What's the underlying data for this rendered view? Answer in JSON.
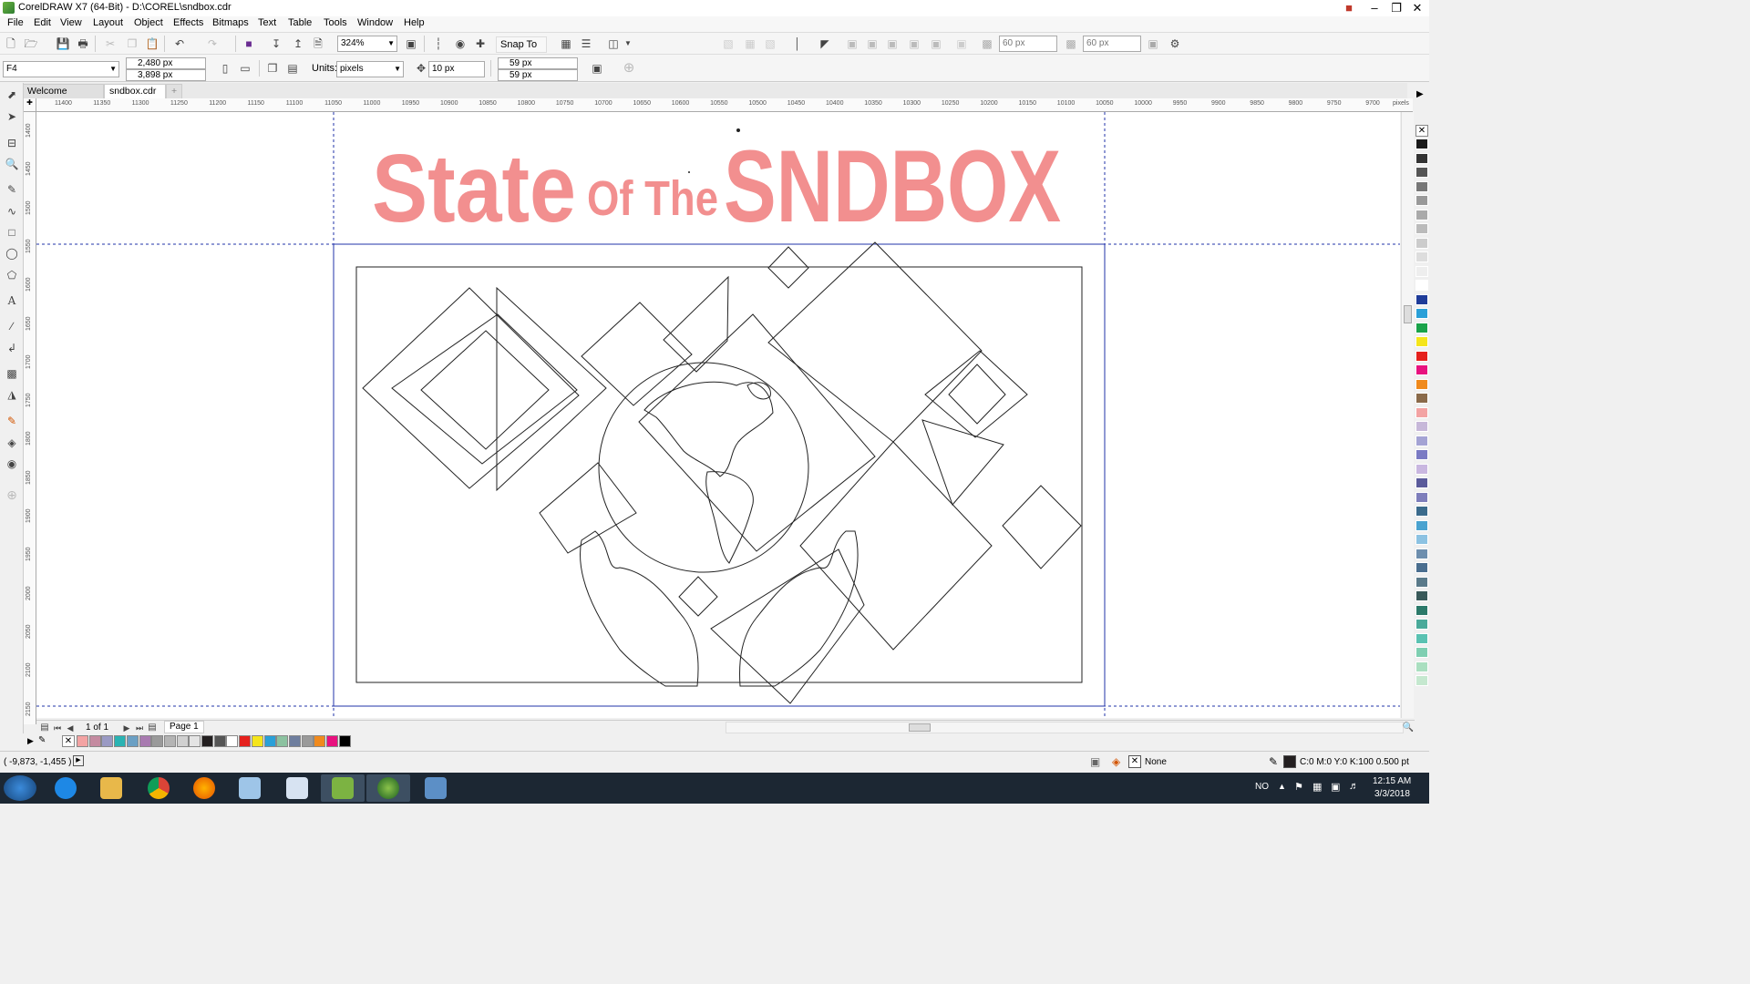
{
  "window": {
    "title": "CorelDRAW X7 (64-Bit) - D:\\COREL\\sndbox.cdr"
  },
  "menu": [
    "File",
    "Edit",
    "View",
    "Layout",
    "Object",
    "Effects",
    "Bitmaps",
    "Text",
    "Table",
    "Tools",
    "Window",
    "Help"
  ],
  "toolbar": {
    "zoom": "324%",
    "snap_label": "Snap To",
    "nudge_w": "60 px",
    "nudge_h": "60 px"
  },
  "property_bar": {
    "page_size": "F4",
    "width": "2,480 px",
    "height": "3,898 px",
    "units_label": "Units:",
    "units_value": "pixels",
    "nudge": "10 px",
    "dup_x": "59 px",
    "dup_y": "59 px"
  },
  "tabs": [
    {
      "label": "Welcome Screen",
      "active": false
    },
    {
      "label": "sndbox.cdr",
      "active": true
    }
  ],
  "hruler": {
    "ticks": [
      "11400",
      "11350",
      "11300",
      "11250",
      "11200",
      "11150",
      "11100",
      "11050",
      "11000",
      "10950",
      "10900",
      "10850",
      "10800",
      "10750",
      "10700",
      "10650",
      "10600",
      "10550",
      "10500",
      "10450",
      "10400",
      "10350",
      "10300",
      "10250",
      "10200",
      "10150",
      "10100",
      "10050",
      "10000",
      "9950",
      "9900",
      "9850",
      "9800",
      "9750",
      "9700"
    ],
    "unit": "pixels"
  },
  "vruler": {
    "ticks": [
      "1400",
      "1450",
      "1500",
      "1550",
      "1600",
      "1650",
      "1700",
      "1750",
      "1800",
      "1850",
      "1900",
      "1950",
      "2000",
      "2050",
      "2100",
      "2150"
    ],
    "unit": "pixels"
  },
  "artwork": {
    "title_word1": "State",
    "title_small": "Of The",
    "title_word2": "SNDBOX",
    "title_color": "#f28f8f"
  },
  "page_nav": {
    "count": "1 of 1",
    "page_tab": "Page 1"
  },
  "status": {
    "cursor": "( -9,873, -1,455 )",
    "fill": "None",
    "outline": "C:0 M:0 Y:0 K:100  0.500 pt",
    "lang": "NO"
  },
  "clock": {
    "time": "12:15 AM",
    "date": "3/3/2018"
  },
  "palette_colors": [
    "#1a1a1a",
    "#333",
    "#555",
    "#777",
    "#999",
    "#aaa",
    "#bbb",
    "#ccc",
    "#ddd",
    "#eee",
    "#fff",
    "#1f3c99",
    "#2aa0d8",
    "#1aa34a",
    "#f5e51b",
    "#e5211d",
    "#e8127f",
    "#f08a1d",
    "#8a6a4a",
    "#f3a3a3",
    "#c7b8d9",
    "#a4a3d4",
    "#7b7bc4",
    "#c9b7e0",
    "#5b5b9b",
    "#7e7ebb",
    "#3b6b8c",
    "#4aa3d0",
    "#8cc2e2",
    "#6e8fae",
    "#4a6e8f",
    "#5a7a8a",
    "#3a5a5a",
    "#2c7a6a",
    "#4aaa9a",
    "#5ac2b2",
    "#7fcfb2",
    "#aadfc0",
    "#c5e8cf"
  ],
  "doc_palette": [
    "#f3a3a3",
    "#c48aa0",
    "#9a9ac4",
    "#2ab3b3",
    "#6ba0c4",
    "#a87ab0",
    "#9a9a9a",
    "#b4b4b4",
    "#d0d0d0",
    "#e4e4e4",
    "#231f20",
    "#555",
    "#fff",
    "#e5211d",
    "#f5e51b",
    "#2aa0d8",
    "#8cc2a0",
    "#6e7e9e",
    "#9a9a9a",
    "#f08a1d",
    "#e8127f",
    "#000"
  ]
}
